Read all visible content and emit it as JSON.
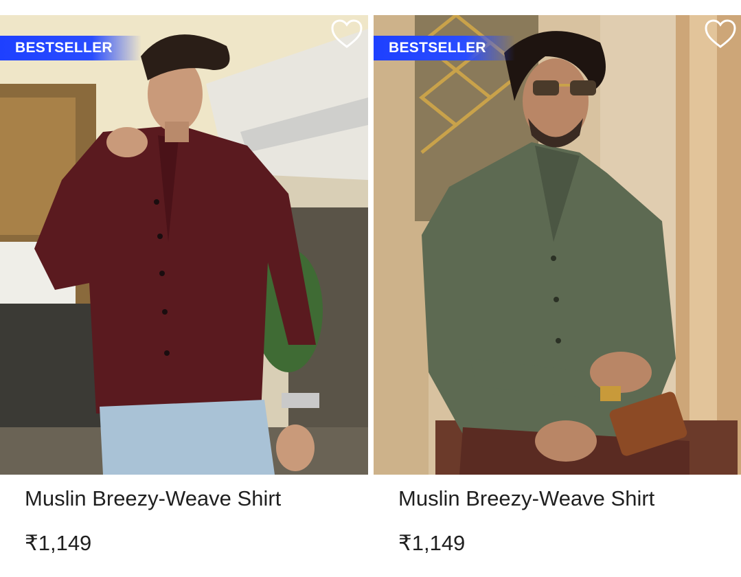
{
  "products": [
    {
      "badge": "BESTSELLER",
      "image_alt": "Man wearing maroon muslin shirt",
      "wishlist_icon": "heart-outline-icon",
      "title": "Muslin Breezy-Weave Shirt",
      "price": "₹1,149",
      "shirt_color": "#5a1a1f"
    },
    {
      "badge": "BESTSELLER",
      "image_alt": "Man wearing olive muslin shirt",
      "wishlist_icon": "heart-outline-icon",
      "title": "Muslin Breezy-Weave Shirt",
      "price": "₹1,149",
      "shirt_color": "#5d6a52"
    }
  ],
  "colors": {
    "badge": "#2a4dff",
    "text": "#1f1f1f"
  }
}
